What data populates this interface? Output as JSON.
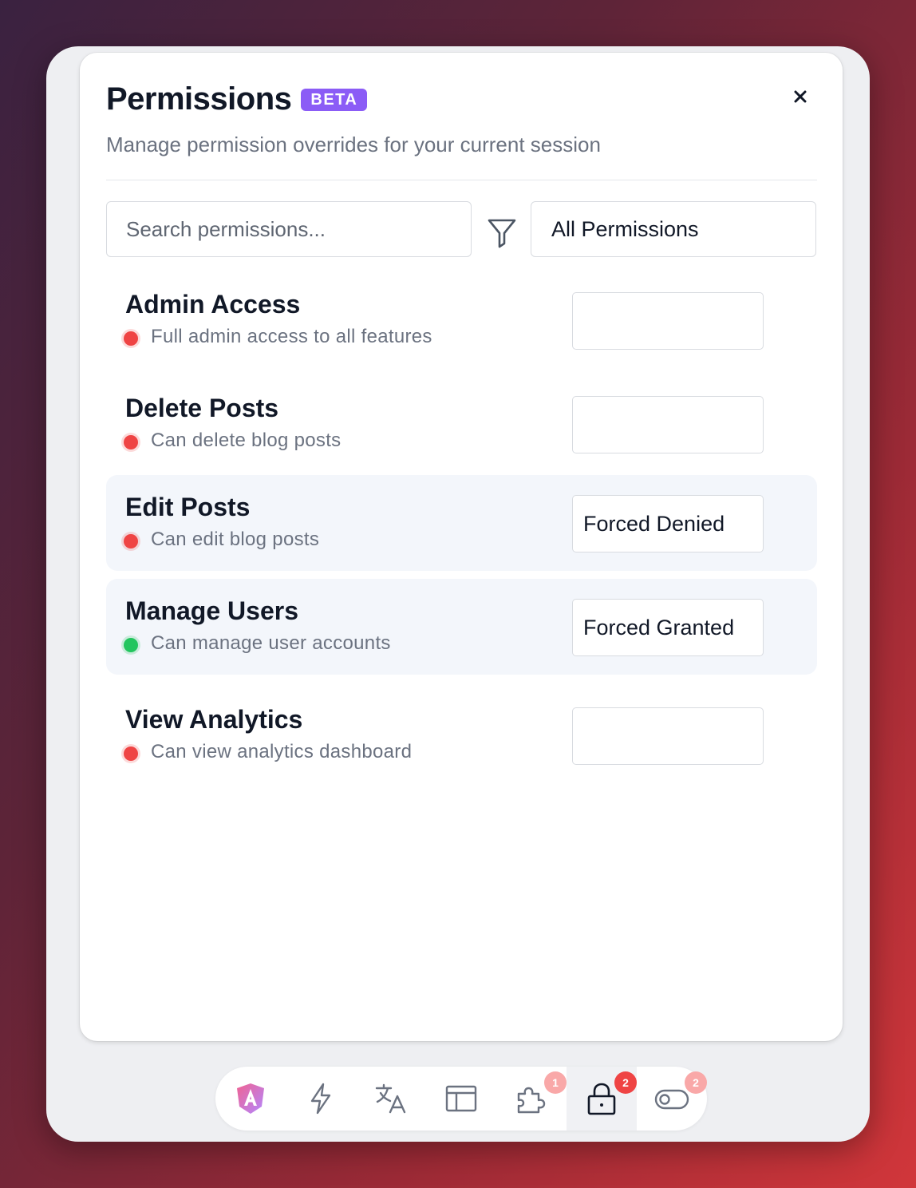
{
  "panel": {
    "title": "Permissions",
    "badge": "BETA",
    "subtitle": "Manage permission overrides for your current session",
    "close_label": "×"
  },
  "search": {
    "placeholder": "Search permissions...",
    "value": ""
  },
  "filter": {
    "selected": "All Permissions"
  },
  "permissions": [
    {
      "name": "Admin Access",
      "description": "Full admin access to all features",
      "status": "denied",
      "override": ""
    },
    {
      "name": "Delete Posts",
      "description": "Can delete blog posts",
      "status": "denied",
      "override": ""
    },
    {
      "name": "Edit Posts",
      "description": "Can edit blog posts",
      "status": "denied",
      "override": "Forced Denied"
    },
    {
      "name": "Manage Users",
      "description": "Can manage user accounts",
      "status": "granted",
      "override": "Forced Granted"
    },
    {
      "name": "View Analytics",
      "description": "Can view analytics dashboard",
      "status": "denied",
      "override": ""
    }
  ],
  "toolbar": {
    "items": [
      {
        "icon": "angular-icon",
        "badge": ""
      },
      {
        "icon": "lightning-icon",
        "badge": ""
      },
      {
        "icon": "translate-icon",
        "badge": ""
      },
      {
        "icon": "layout-icon",
        "badge": ""
      },
      {
        "icon": "puzzle-icon",
        "badge": "1"
      },
      {
        "icon": "lock-icon",
        "badge": "2"
      },
      {
        "icon": "toggle-icon",
        "badge": "2"
      }
    ]
  },
  "colors": {
    "accent": "#8b5cf6",
    "denied": "#ef4444",
    "granted": "#22c55e",
    "active_row": "#f3f6fb"
  }
}
